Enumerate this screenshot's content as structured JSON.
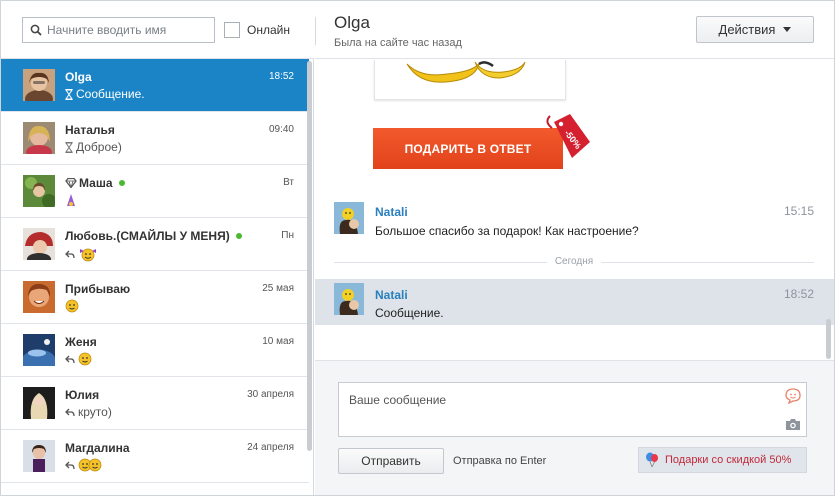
{
  "search": {
    "placeholder": "Начните вводить имя"
  },
  "filter": {
    "online_label": "Онлайн"
  },
  "contacts": [
    {
      "name": "Olga",
      "time": "18:52",
      "preview": "Сообщение.",
      "status": "pending",
      "active": true,
      "online": false
    },
    {
      "name": "Наталья",
      "time": "09:40",
      "preview": "Доброе)",
      "status": "pending",
      "active": false,
      "online": false
    },
    {
      "name": "Маша",
      "time": "Вт",
      "preview": "",
      "status": "none",
      "active": false,
      "online": true
    },
    {
      "name": "Любовь.(СМАЙЛЫ У МЕНЯ)",
      "time": "Пн",
      "preview": "",
      "status": "replied",
      "active": false,
      "online": true
    },
    {
      "name": "Прибываю",
      "time": "25 мая",
      "preview": "",
      "status": "none",
      "active": false,
      "online": false
    },
    {
      "name": "Женя",
      "time": "10 мая",
      "preview": "",
      "status": "replied",
      "active": false,
      "online": false
    },
    {
      "name": "Юлия",
      "time": "30 апреля",
      "preview": "круто)",
      "status": "replied",
      "active": false,
      "online": false
    },
    {
      "name": "Магдалина",
      "time": "24 апреля",
      "preview": "",
      "status": "replied",
      "active": false,
      "online": false
    }
  ],
  "header": {
    "title": "Olga",
    "subtitle": "Была на сайте час назад",
    "actions_label": "Действия"
  },
  "gift": {
    "reply_button": "ПОДАРИТЬ В ОТВЕТ",
    "discount_tag": "-50%"
  },
  "messages": [
    {
      "sender": "Natali",
      "time": "15:15",
      "text": "Большое спасибо за подарок! Как настроение?",
      "highlighted": false
    },
    {
      "sender": "Natali",
      "time": "18:52",
      "text": "Сообщение.",
      "highlighted": true
    }
  ],
  "day_separator": "Сегодня",
  "composer": {
    "placeholder": "Ваше сообщение",
    "send_label": "Отправить",
    "enter_hint": "Отправка по Enter",
    "gifts_promo": "Подарки со скидкой 50%"
  },
  "colors": {
    "accent": "#1a84c7",
    "gift_button": "#e84b22",
    "online": "#4cb82f",
    "promo_text": "#c2283a",
    "sender": "#2a7fbd"
  }
}
